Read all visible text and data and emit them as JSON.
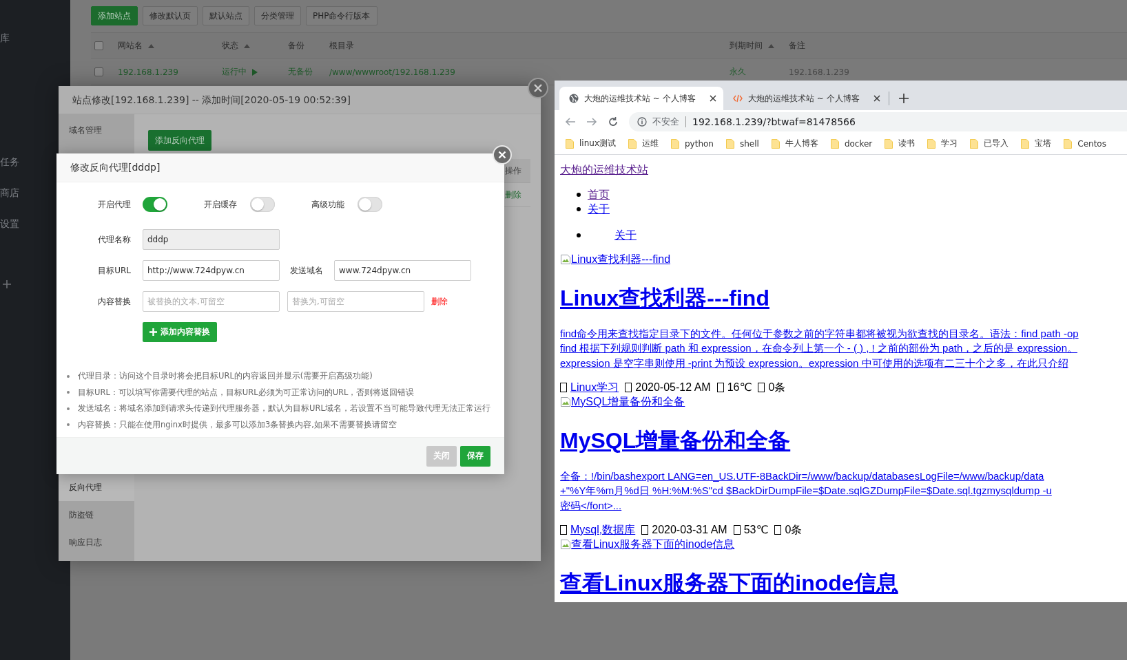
{
  "sidebar": {
    "items": [
      {
        "label": "库"
      },
      {
        "label": "任务"
      },
      {
        "label": "商店"
      },
      {
        "label": "设置"
      }
    ]
  },
  "toolbar": {
    "buttons": [
      {
        "label": "添加站点",
        "kind": "primary"
      },
      {
        "label": "修改默认页",
        "kind": "default"
      },
      {
        "label": "默认站点",
        "kind": "default"
      },
      {
        "label": "分类管理",
        "kind": "default"
      },
      {
        "label": "PHP命令行版本",
        "kind": "default"
      }
    ]
  },
  "site_table": {
    "all_checked": false,
    "columns": [
      {
        "label": "网站名",
        "sortable": true
      },
      {
        "label": "状态",
        "sortable": true
      },
      {
        "label": "备份",
        "sortable": false
      },
      {
        "label": "根目录",
        "sortable": false
      },
      {
        "label": "到期时间",
        "sortable": true
      },
      {
        "label": "备注",
        "sortable": false
      }
    ],
    "rows": [
      {
        "checked": false,
        "cells": [
          {
            "text": "192.168.1.239",
            "kind": "link"
          },
          {
            "text": "运行中",
            "kind": "status"
          },
          {
            "text": "无备份",
            "kind": "link"
          },
          {
            "text": "/www/wwwroot/192.168.1.239",
            "kind": "link"
          },
          {
            "text": "永久",
            "kind": "link"
          },
          {
            "text": "192.168.1.239",
            "kind": "text"
          }
        ]
      }
    ]
  },
  "site_editor": {
    "title": "站点修改[192.168.1.239] -- 添加时间[2020-05-19 00:52:39]",
    "menu": [
      {
        "label": "域名管理",
        "selected": false
      },
      {
        "label": "反向代理",
        "selected": true
      },
      {
        "label": "防盗链",
        "selected": false
      },
      {
        "label": "响应日志",
        "selected": false
      }
    ],
    "add_button": "添加反向代理",
    "proxy_table": {
      "column": "操作",
      "action": "删除"
    }
  },
  "proxy_dialog": {
    "title": "修改反向代理[dddp]",
    "switches": [
      {
        "label": "开启代理",
        "on": true
      },
      {
        "label": "开启缓存",
        "on": false
      },
      {
        "label": "高级功能",
        "on": false
      }
    ],
    "rows": [
      {
        "label": "代理名称",
        "inputs": [
          {
            "value": "dddp",
            "disabled": true
          }
        ]
      },
      {
        "label": "目标URL",
        "inputs": [
          {
            "value": "http://www.724dpyw.cn",
            "disabled": false
          },
          {
            "label": "发送域名",
            "value": "www.724dpyw.cn",
            "disabled": false
          }
        ]
      },
      {
        "label": "内容替换",
        "inputs": [
          {
            "placeholder": "被替换的文本,可留空",
            "disabled": false
          },
          {
            "placeholder": "替换为,可留空",
            "disabled": false
          }
        ],
        "delete_link": "删除"
      }
    ],
    "add_replace_button": "添加内容替换",
    "notes": [
      "代理目录：访问这个目录时将会把目标URL的内容返回并显示(需要开启高级功能)",
      "目标URL：可以填写你需要代理的站点，目标URL必须为可正常访问的URL，否则将返回错误",
      "发送域名：将域名添加到请求头传递到代理服务器，默认为目标URL域名，若设置不当可能导致代理无法正常运行",
      "内容替换：只能在使用nginx时提供，最多可以添加3条替换内容,如果不需要替换请留空"
    ],
    "buttons": [
      {
        "label": "关闭",
        "kind": "secondary"
      },
      {
        "label": "保存",
        "kind": "primary"
      }
    ]
  },
  "browser": {
    "tabs": [
      {
        "title": "大炮的运维技术站 ~ 个人博客",
        "selected": true,
        "kind": "globe"
      },
      {
        "title": "大炮的运维技术站 ~ 个人博客",
        "selected": false,
        "kind": "code"
      }
    ],
    "security": "不安全",
    "url": "192.168.1.239/?btwaf=81478566",
    "bookmarks": [
      "linux测试",
      "运维",
      "python",
      "shell",
      "牛人博客",
      "docker",
      "读书",
      "学习",
      "已导入",
      "宝塔",
      "Centos"
    ],
    "page": {
      "site_title": {
        "text": "大炮的运维技术站",
        "visited": true
      },
      "nav": [
        {
          "label": "首页",
          "visited": true
        },
        {
          "label": "关于",
          "visited": false
        }
      ],
      "nav2": [
        {
          "label": "关于",
          "visited": false
        }
      ],
      "posts": [
        {
          "image_alt": "Linux查找利器---find",
          "title": "Linux查找利器---find",
          "excerpt": [
            "find命令用来查找指定目录下的文件。任何位于参数之前的字符串都将被视为欲查找的目录名。语法：find path -op",
            "find 根据下列规则判断 path 和 expression，在命令列上第一个 - ( ) , ! 之前的部份为 path，之后的是 expression。",
            "expression 是空字串则使用 -print 为预设 expression。expression 中可使用的选项有二三十个之多，在此只介绍"
          ],
          "meta": {
            "category": "Linux学习",
            "date": "2020-05-12 AM",
            "heat": "16℃",
            "comments": "0条"
          }
        },
        {
          "image_alt": "MySQL增量备份和全备",
          "title": "MySQL增量备份和全备",
          "excerpt": [
            "全备：!/bin/bashexport LANG=en_US.UTF-8BackDir=/www/backup/databasesLogFile=/www/backup/data",
            "+\"%Y年%m月%d日 %H:%M:%S\"cd $BackDirDumpFile=$Date.sqlGZDumpFile=$Date.sql.tgzmysqldump -u",
            "密码</font>..."
          ],
          "meta": {
            "category": "Mysql,数据库",
            "date": "2020-03-31 AM",
            "heat": "53℃",
            "comments": "0条"
          }
        },
        {
          "image_alt": "查看Linux服务器下面的inode信息",
          "title": "查看Linux服务器下面的inode信息"
        }
      ]
    }
  }
}
